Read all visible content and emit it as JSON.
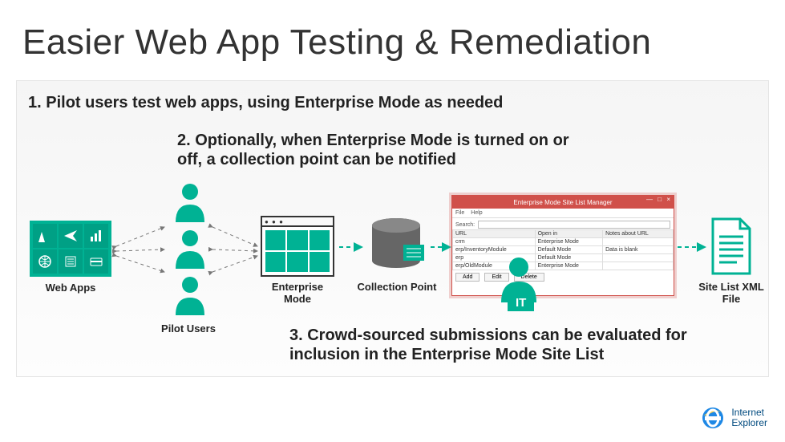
{
  "title": "Easier Web App Testing & Remediation",
  "steps": {
    "s1": "1. Pilot users test web apps, using Enterprise Mode as needed",
    "s2": "2. Optionally, when Enterprise Mode is turned on or off, a collection point can be notified",
    "s3": "3. Crowd-sourced submissions can be evaluated for inclusion in the Enterprise Mode Site List"
  },
  "labels": {
    "webapps": "Web Apps",
    "pilot": "Pilot Users",
    "em": "Enterprise Mode",
    "cp": "Collection Point",
    "it": "IT",
    "xml": "Site List XML File"
  },
  "admin": {
    "title": "Enterprise Mode Site List Manager",
    "menu": [
      "File",
      "Help"
    ],
    "search_label": "Search:",
    "search_placeholder": "",
    "columns": [
      "URL",
      "Open in",
      "Notes about URL"
    ],
    "rows": [
      {
        "url": "crm",
        "openin": "Enterprise Mode",
        "notes": ""
      },
      {
        "url": "erp/InventoryModule",
        "openin": "Default Mode",
        "notes": "Data is blank"
      },
      {
        "url": "erp",
        "openin": "Default Mode",
        "notes": ""
      },
      {
        "url": "erp/OldModule",
        "openin": "Enterprise Mode",
        "notes": ""
      }
    ],
    "buttons": [
      "Add",
      "Edit",
      "Delete"
    ]
  },
  "footer": {
    "brand1": "Internet",
    "brand2": "Explorer"
  },
  "colors": {
    "accent": "#00b294",
    "red": "#d0504a",
    "link": "#004a7f"
  }
}
